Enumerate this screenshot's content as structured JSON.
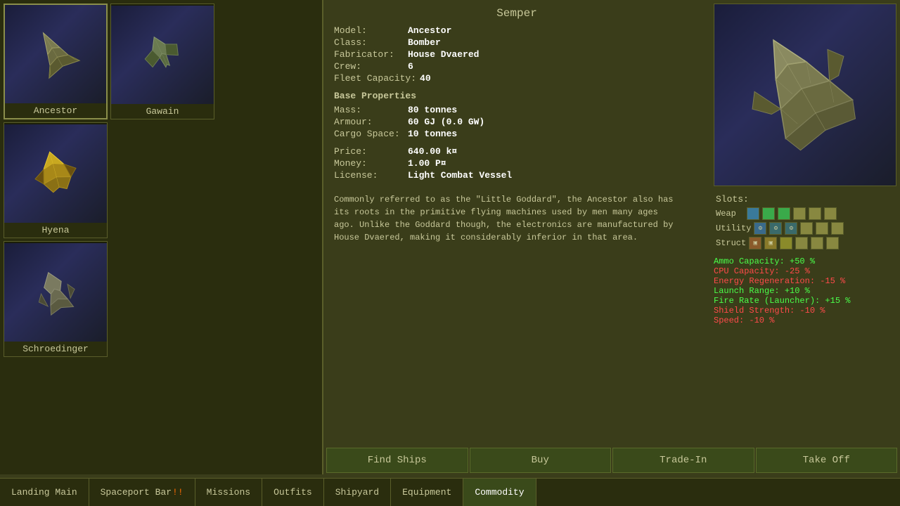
{
  "title": "Semper",
  "ships": [
    {
      "id": "ancestor",
      "name": "Ancestor",
      "selected": true
    },
    {
      "id": "hyena",
      "name": "Hyena",
      "selected": false
    },
    {
      "id": "schroedinger",
      "name": "Schroedinger",
      "selected": false
    },
    {
      "id": "gawain",
      "name": "Gawain",
      "selected": false
    }
  ],
  "ship_detail": {
    "name": "Ancestor",
    "model_label": "Model:",
    "model_value": "Ancestor",
    "class_label": "Class:",
    "class_value": "Bomber",
    "fabricator_label": "Fabricator:",
    "fabricator_value": "House Dvaered",
    "crew_label": "Crew:",
    "crew_value": "6",
    "fleet_capacity_label": "Fleet Capacity:",
    "fleet_capacity_value": "40",
    "base_properties": "Base Properties",
    "mass_label": "Mass:",
    "mass_value": "80 tonnes",
    "armour_label": "Armour:",
    "armour_value": "60 GJ (0.0 GW)",
    "cargo_space_label": "Cargo Space:",
    "cargo_space_value": "10 tonnes",
    "price_label": "Price:",
    "price_value": "640.00 k¤",
    "money_label": "Money:",
    "money_value": "1.00 P¤",
    "license_label": "License:",
    "license_value": "Light Combat Vessel",
    "description": "Commonly referred to as the \"Little Goddard\", the Ancestor also has its roots in the primitive flying machines used by men many ages ago. Unlike the Goddard though, the electronics are manufactured by House Dvaered, making it considerably inferior in that area.",
    "slots_title": "Slots:",
    "slot_weap_label": "Weap",
    "slot_util_label": "Utility",
    "slot_struct_label": "Struct",
    "modifiers": [
      {
        "text": "Ammo Capacity: +50 %",
        "positive": true
      },
      {
        "text": "CPU Capacity: -25 %",
        "positive": false
      },
      {
        "text": "Energy Regeneration: -15 %",
        "positive": false
      },
      {
        "text": "Launch Range: +10 %",
        "positive": true
      },
      {
        "text": "Fire Rate (Launcher): +15 %",
        "positive": true
      },
      {
        "text": "Shield Strength: -10 %",
        "positive": false
      },
      {
        "text": "Speed: -10 %",
        "positive": false
      }
    ]
  },
  "action_buttons": {
    "find_ships": "Find Ships",
    "buy": "Buy",
    "trade_in": "Trade-In",
    "take_off": "Take Off"
  },
  "nav_tabs": [
    {
      "id": "landing-main",
      "label": "Landing Main",
      "badge": "",
      "active": false
    },
    {
      "id": "spaceport-bar",
      "label": "Spaceport Bar",
      "badge": "!!",
      "active": false
    },
    {
      "id": "missions",
      "label": "Missions",
      "badge": "",
      "active": false
    },
    {
      "id": "outfits",
      "label": "Outfits",
      "badge": "",
      "active": false
    },
    {
      "id": "shipyard",
      "label": "Shipyard",
      "badge": "",
      "active": false
    },
    {
      "id": "equipment",
      "label": "Equipment",
      "badge": "",
      "active": false
    },
    {
      "id": "commodity",
      "label": "Commodity",
      "badge": "",
      "active": true
    }
  ]
}
